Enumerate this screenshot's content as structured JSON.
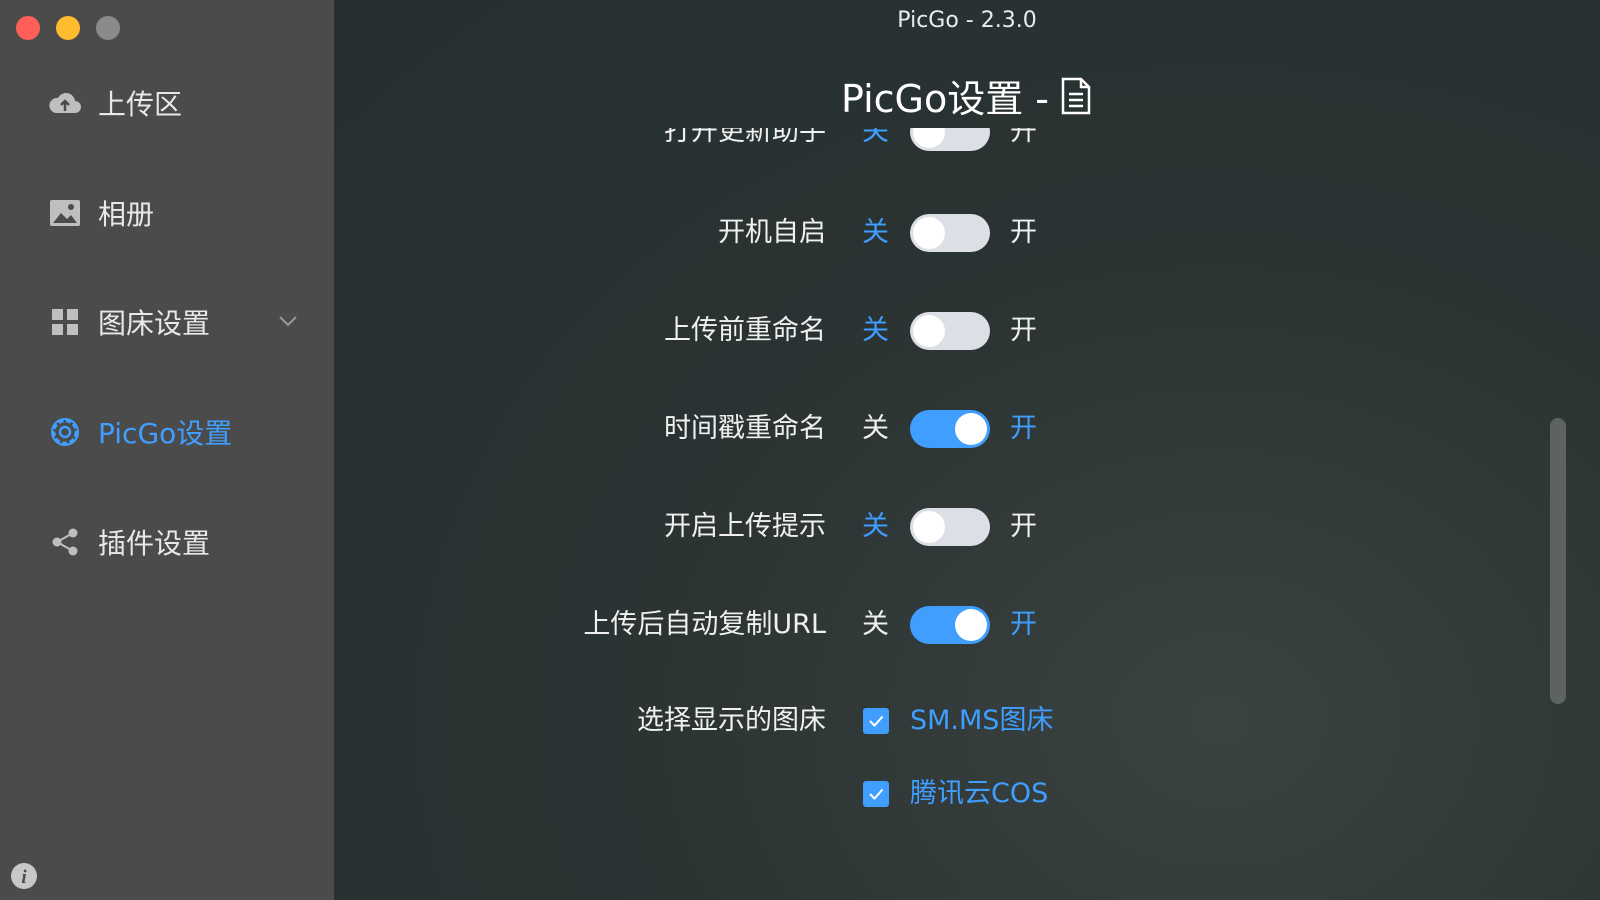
{
  "window": {
    "title": "PicGo - 2.3.0"
  },
  "sidebar": {
    "items": [
      {
        "label": "上传区",
        "icon": "cloud-upload-icon"
      },
      {
        "label": "相册",
        "icon": "image-icon"
      },
      {
        "label": "图床设置",
        "icon": "grid-icon"
      },
      {
        "label": "PicGo设置",
        "icon": "gear-icon"
      },
      {
        "label": "插件设置",
        "icon": "share-icon"
      }
    ],
    "active_index": 3,
    "info_icon": "info-icon"
  },
  "main": {
    "page_title": "PicGo设置 -",
    "settings": [
      {
        "label": "打开更新助手",
        "off": "关",
        "on": "开",
        "enabled": false
      },
      {
        "label": "开机自启",
        "off": "关",
        "on": "开",
        "enabled": false
      },
      {
        "label": "上传前重命名",
        "off": "关",
        "on": "开",
        "enabled": false
      },
      {
        "label": "时间戳重命名",
        "off": "关",
        "on": "开",
        "enabled": true
      },
      {
        "label": "开启上传提示",
        "off": "关",
        "on": "开",
        "enabled": false
      },
      {
        "label": "上传后自动复制URL",
        "off": "关",
        "on": "开",
        "enabled": true
      }
    ],
    "picbed_select": {
      "label": "选择显示的图床",
      "options": [
        {
          "label": "SM.MS图床",
          "checked": true
        },
        {
          "label": "腾讯云COS",
          "checked": true
        }
      ]
    }
  },
  "colors": {
    "accent": "#409eff",
    "sidebar_bg": "#4b4b4b",
    "main_bg": "#2b3232"
  }
}
